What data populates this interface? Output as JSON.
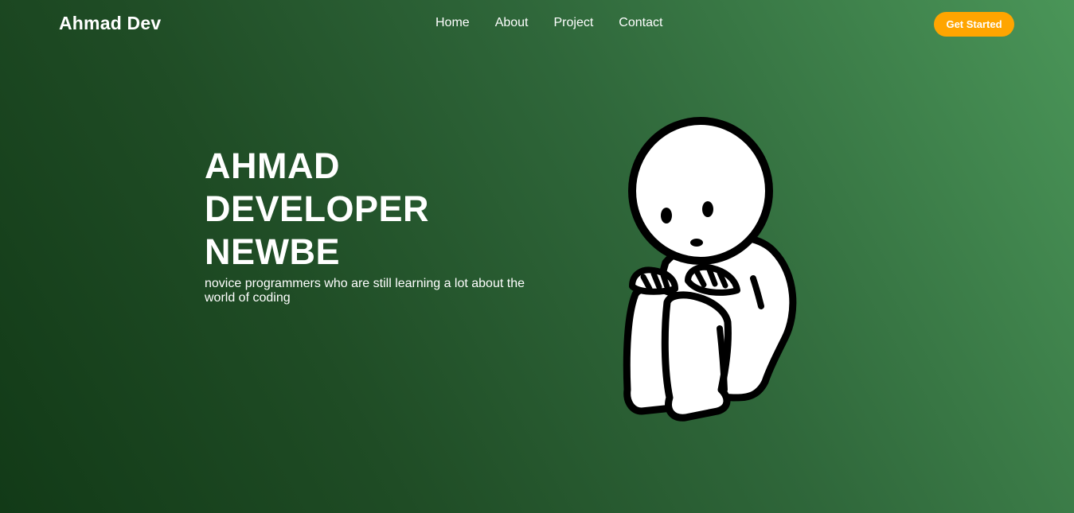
{
  "nav": {
    "brand": "Ahmad Dev",
    "links": [
      {
        "label": "Home"
      },
      {
        "label": "About"
      },
      {
        "label": "Project"
      },
      {
        "label": "Contact"
      }
    ],
    "cta_label": "Get Started"
  },
  "hero": {
    "title_lines": [
      "AHMAD",
      "DEVELOPER",
      "NEWBE"
    ],
    "description": "novice programmers who are still learning a lot about the world of coding",
    "illustration": "sitting-stick-figure-icon"
  },
  "colors": {
    "cta_background": "#ffa500",
    "background_dark": "#123a17",
    "background_light": "#4a9558",
    "text": "#ffffff"
  }
}
